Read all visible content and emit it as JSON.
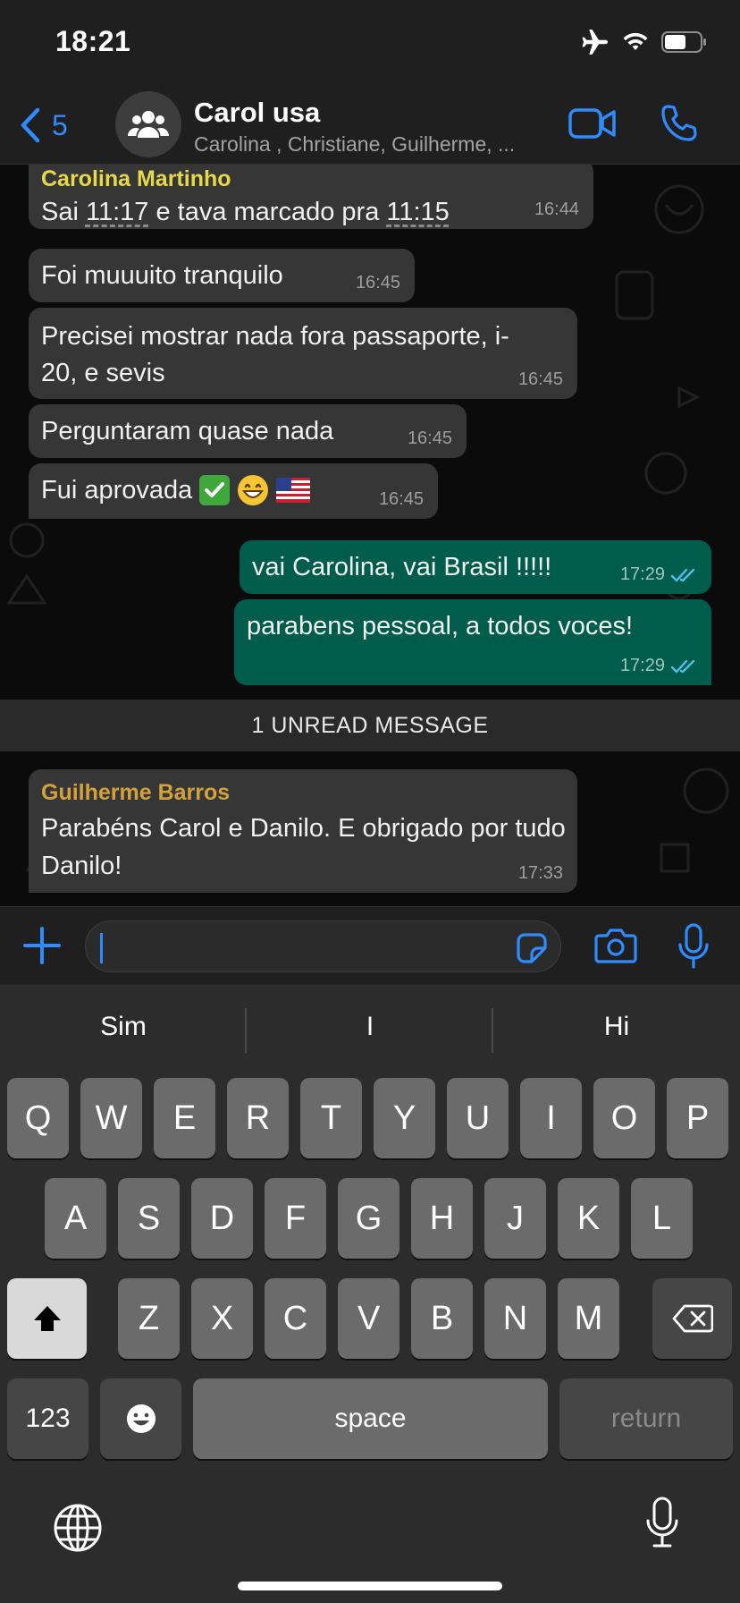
{
  "status": {
    "time": "18:21"
  },
  "header": {
    "back_count": "5",
    "title": "Carol usa",
    "subtitle": "Carolina , Christiane, Guilherme, ..."
  },
  "messages": [
    {
      "sender": "Carolina  Martinho",
      "sender_color": "#e5d94a",
      "parts": [
        "Sai ",
        "11:17",
        " e tava marcado pra ",
        "11:15"
      ],
      "time": "16:44"
    },
    {
      "text": "Foi muuuito tranquilo",
      "time": "16:45"
    },
    {
      "text": "Precisei mostrar nada fora passaporte, i-20, e sevis",
      "time": "16:45"
    },
    {
      "text": "Perguntaram quase nada",
      "time": "16:45"
    },
    {
      "text": "Fui aprovada",
      "time": "16:45"
    },
    {
      "text": "vai Carolina, vai Brasil !!!!!",
      "time": "17:29",
      "outgoing": true
    },
    {
      "text": "parabens pessoal, a todos voces!",
      "time": "17:29",
      "outgoing": true
    },
    {
      "sender": "Guilherme Barros",
      "sender_color": "#d4a13a",
      "text": "Parabéns Carol e Danilo. E obrigado por tudo Danilo!",
      "time": "17:33"
    }
  ],
  "unread_label": "1 UNREAD MESSAGE",
  "composer": {
    "value": ""
  },
  "keyboard": {
    "suggestions": [
      "Sim",
      "I",
      "Hi"
    ],
    "row1": [
      "Q",
      "W",
      "E",
      "R",
      "T",
      "Y",
      "U",
      "I",
      "O",
      "P"
    ],
    "row2": [
      "A",
      "S",
      "D",
      "F",
      "G",
      "H",
      "J",
      "K",
      "L"
    ],
    "row3": [
      "Z",
      "X",
      "C",
      "V",
      "B",
      "N",
      "M"
    ],
    "numbers_label": "123",
    "space_label": "space",
    "return_label": "return"
  },
  "colors": {
    "accent": "#2f8cff",
    "outgoing_bubble": "#005c4b",
    "incoming_bubble": "#363636",
    "read_ticks": "#53bdeb"
  }
}
